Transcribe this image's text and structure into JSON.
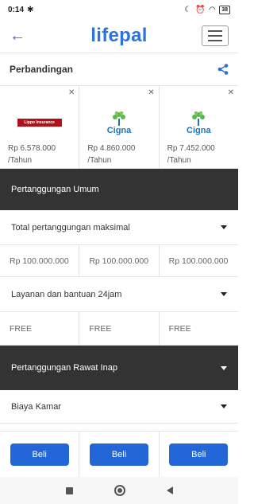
{
  "status_bar": {
    "time": "0:14",
    "battery": "38"
  },
  "header": {
    "logo_text": "lifepal",
    "brand_color": "#2d74da"
  },
  "compare": {
    "title": "Perbandingan"
  },
  "products": [
    {
      "logo": "Lippo Insurance",
      "price": "Rp 6.578.000",
      "period": "/Tahun"
    },
    {
      "logo": "Cigna",
      "price": "Rp 4.860.000",
      "period": "/Tahun"
    },
    {
      "logo": "Cigna",
      "price": "Rp 7.452.000",
      "period": "/Tahun"
    }
  ],
  "sections": {
    "umum": {
      "title": "Pertanggungan Umum",
      "rows": [
        {
          "label": "Total pertanggungan maksimal",
          "values": [
            "Rp 100.000.000",
            "Rp 100.000.000",
            "Rp 100.000.000"
          ]
        },
        {
          "label": "Layanan dan bantuan 24jam",
          "values": [
            "FREE",
            "FREE",
            "FREE"
          ]
        }
      ]
    },
    "rawat_inap": {
      "title": "Pertanggungan Rawat Inap",
      "rows": [
        {
          "label": "Biaya Kamar"
        }
      ]
    }
  },
  "buy": {
    "label": "Beli",
    "color": "#2266d8"
  }
}
